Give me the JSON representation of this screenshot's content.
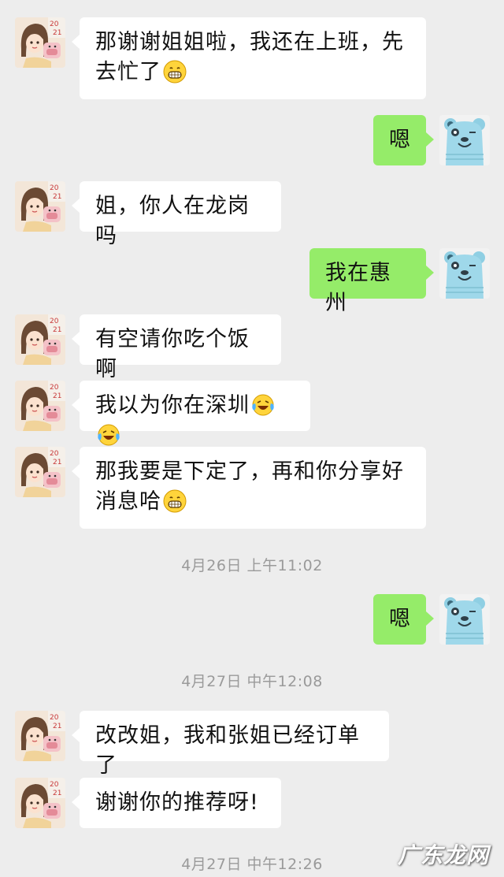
{
  "messages": [
    {
      "side": "left",
      "sender": "contact",
      "text": "那谢谢姐姐啦，我还在上班，先去忙了",
      "emoji": [
        "grin"
      ]
    },
    {
      "side": "right",
      "sender": "self",
      "text": "嗯",
      "emoji": []
    },
    {
      "side": "left",
      "sender": "contact",
      "text": "姐，你人在龙岗吗",
      "emoji": []
    },
    {
      "side": "right",
      "sender": "self",
      "text": "我在惠州",
      "emoji": []
    },
    {
      "side": "left",
      "sender": "contact",
      "text": "有空请你吃个饭啊",
      "emoji": []
    },
    {
      "side": "left",
      "sender": "contact",
      "text": "我以为你在深圳",
      "emoji": [
        "laugh-cry",
        "laugh-cry"
      ]
    },
    {
      "side": "left",
      "sender": "contact",
      "text": "那我要是下定了，再和你分享好消息哈",
      "emoji": [
        "grin"
      ]
    },
    {
      "side": "right",
      "sender": "self",
      "text": "嗯",
      "emoji": []
    },
    {
      "side": "left",
      "sender": "contact",
      "text": "改改姐，我和张姐已经订单了",
      "emoji": []
    },
    {
      "side": "left",
      "sender": "contact",
      "text": "谢谢你的推荐呀!",
      "emoji": []
    }
  ],
  "timestamps": [
    "4月26日 上午11:02",
    "4月27日 中午12:08",
    "4月27日 中午12:26"
  ],
  "avatars": {
    "contact": {
      "icon": "girl-cartoon-avatar-icon",
      "badge_text": "2021"
    },
    "self": {
      "icon": "blue-bear-avatar-icon"
    }
  },
  "watermark": "广东龙网",
  "colors": {
    "background": "#ededed",
    "incoming_bubble": "#ffffff",
    "outgoing_bubble": "#95ec69",
    "timestamp": "#9a9a9a"
  }
}
